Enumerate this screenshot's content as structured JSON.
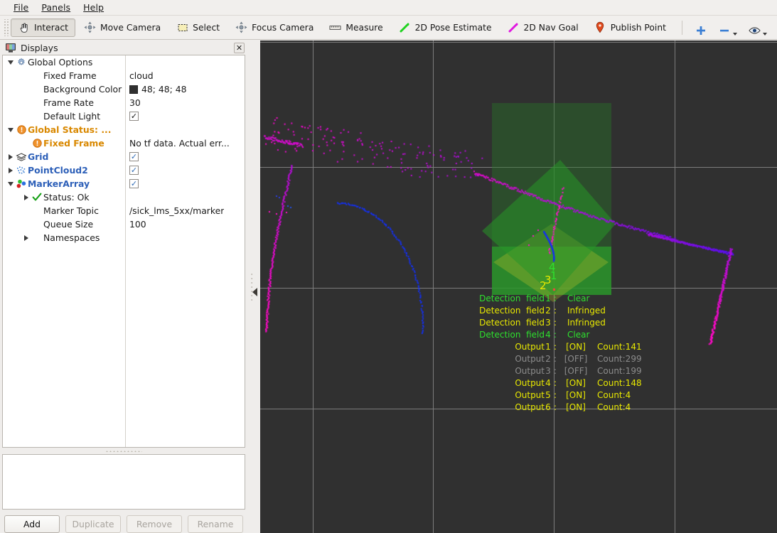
{
  "menu": {
    "items": [
      {
        "label": "File",
        "mnemonic": "F"
      },
      {
        "label": "Panels",
        "mnemonic": "P"
      },
      {
        "label": "Help",
        "mnemonic": "H"
      }
    ]
  },
  "toolbar": {
    "tools": [
      {
        "label": "Interact",
        "icon": "hand-cursor-icon",
        "checked": true
      },
      {
        "label": "Move Camera",
        "icon": "move-camera-icon",
        "checked": false
      },
      {
        "label": "Select",
        "icon": "select-rect-icon",
        "checked": false
      },
      {
        "label": "Focus Camera",
        "icon": "focus-camera-icon",
        "checked": false
      },
      {
        "label": "Measure",
        "icon": "ruler-icon",
        "checked": false
      },
      {
        "label": "2D Pose Estimate",
        "icon": "green-arrow-icon",
        "checked": false
      },
      {
        "label": "2D Nav Goal",
        "icon": "magenta-arrow-icon",
        "checked": false
      },
      {
        "label": "Publish Point",
        "icon": "map-pin-icon",
        "checked": false
      }
    ],
    "extra_buttons": [
      {
        "icon": "plus-icon",
        "name": "add-tool-button"
      },
      {
        "icon": "minus-icon",
        "name": "remove-tool-button"
      },
      {
        "icon": "eye-icon",
        "name": "visibility-button"
      }
    ]
  },
  "displays": {
    "title": "Displays",
    "title_icon": "monitor-icon",
    "close_label": "✕",
    "tree": [
      {
        "indent": 0,
        "twisty": "down",
        "icon": "gear-icon",
        "label": "Global Options",
        "label_style": "plain",
        "value_type": "none"
      },
      {
        "indent": 1,
        "twisty": "none",
        "icon": "none",
        "label": "Fixed Frame",
        "label_style": "plain",
        "value_type": "text",
        "value": "cloud"
      },
      {
        "indent": 1,
        "twisty": "none",
        "icon": "none",
        "label": "Background Color",
        "label_style": "plain",
        "value_type": "color",
        "value": "48; 48; 48",
        "color": "#303030"
      },
      {
        "indent": 1,
        "twisty": "none",
        "icon": "none",
        "label": "Frame Rate",
        "label_style": "plain",
        "value_type": "text",
        "value": "30"
      },
      {
        "indent": 1,
        "twisty": "none",
        "icon": "none",
        "label": "Default Light",
        "label_style": "plain",
        "value_type": "check-black"
      },
      {
        "indent": 0,
        "twisty": "down",
        "icon": "warn-icon",
        "label": "Global Status: ...",
        "label_style": "orange",
        "value_type": "none"
      },
      {
        "indent": 1,
        "twisty": "none",
        "icon": "warn-icon",
        "label": "Fixed Frame",
        "label_style": "orange",
        "value_type": "text",
        "value": "No tf data.  Actual err..."
      },
      {
        "indent": 0,
        "twisty": "right",
        "icon": "grid-icon",
        "label": "Grid",
        "label_style": "blue",
        "value_type": "check-blue"
      },
      {
        "indent": 0,
        "twisty": "right",
        "icon": "pointcloud-icon",
        "label": "PointCloud2",
        "label_style": "blue",
        "value_type": "check-blue"
      },
      {
        "indent": 0,
        "twisty": "down",
        "icon": "markerarray-icon",
        "label": "MarkerArray",
        "label_style": "blue",
        "value_type": "check-blue"
      },
      {
        "indent": 1,
        "twisty": "right",
        "icon": "check-icon",
        "label": "Status: Ok",
        "label_style": "plain",
        "value_type": "none"
      },
      {
        "indent": 1,
        "twisty": "none",
        "icon": "none",
        "label": "Marker Topic",
        "label_style": "plain",
        "value_type": "text",
        "value": "/sick_lms_5xx/marker"
      },
      {
        "indent": 1,
        "twisty": "none",
        "icon": "none",
        "label": "Queue Size",
        "label_style": "plain",
        "value_type": "text",
        "value": "100"
      },
      {
        "indent": 1,
        "twisty": "right",
        "icon": "none",
        "label": "Namespaces",
        "label_style": "plain",
        "value_type": "none"
      }
    ],
    "buttons": [
      {
        "label": "Add",
        "enabled": true
      },
      {
        "label": "Duplicate",
        "enabled": false
      },
      {
        "label": "Remove",
        "enabled": false
      },
      {
        "label": "Rename",
        "enabled": false
      }
    ]
  },
  "viewport": {
    "background_color": "#303030",
    "grid_color": "#7d7d7d",
    "overlay": {
      "detection_fields": [
        {
          "label": "Detection  field",
          "index": "1",
          "sep": ":",
          "status": "Clear",
          "color": "#2ee02e"
        },
        {
          "label": "Detection  field",
          "index": "2",
          "sep": ":",
          "status": "Infringed",
          "color": "#e8e800"
        },
        {
          "label": "Detection  field",
          "index": "3",
          "sep": ":",
          "status": "Infringed",
          "color": "#e8e800"
        },
        {
          "label": "Detection  field",
          "index": "4",
          "sep": ":",
          "status": "Clear",
          "color": "#2ee02e"
        }
      ],
      "outputs": [
        {
          "label": "Output",
          "index": "1",
          "sep": ":",
          "state": "[ON]",
          "count": "Count:141",
          "color": "#e8e800"
        },
        {
          "label": "Output",
          "index": "2",
          "sep": ":",
          "state": "[OFF]",
          "count": "Count:299",
          "color": "#8c8c8c"
        },
        {
          "label": "Output",
          "index": "3",
          "sep": ":",
          "state": "[OFF]",
          "count": "Count:199",
          "color": "#8c8c8c"
        },
        {
          "label": "Output",
          "index": "4",
          "sep": ":",
          "state": "[ON]",
          "count": "Count:148",
          "color": "#e8e800"
        },
        {
          "label": "Output",
          "index": "5",
          "sep": ":",
          "state": "[ON]",
          "count": "Count:4",
          "color": "#e8e800"
        },
        {
          "label": "Output",
          "index": "6",
          "sep": ":",
          "state": "[ON]",
          "count": "Count:4",
          "color": "#e8e800"
        }
      ]
    },
    "field_markers": [
      {
        "number": "1",
        "color": "#2ee02e"
      },
      {
        "number": "2",
        "color": "#e8e800"
      },
      {
        "number": "3",
        "color": "#e8e800"
      },
      {
        "number": "4",
        "color": "#2ee02e"
      }
    ]
  }
}
